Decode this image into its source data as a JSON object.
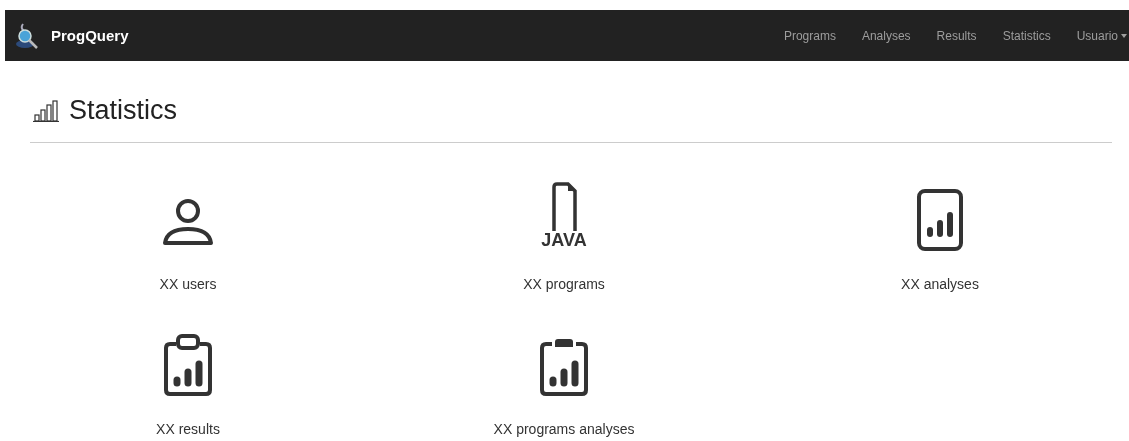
{
  "navbar": {
    "brand": "ProgQuery",
    "links": [
      {
        "label": "Programs"
      },
      {
        "label": "Analyses"
      },
      {
        "label": "Results"
      },
      {
        "label": "Statistics"
      }
    ],
    "user_menu": "Usuario"
  },
  "page_title": "Statistics",
  "stats": [
    {
      "kind": "user",
      "label": "XX users"
    },
    {
      "kind": "java-file",
      "icon_text": "JAVA",
      "label": "XX programs"
    },
    {
      "kind": "chart-doc",
      "label": "XX analyses"
    },
    {
      "kind": "clipboard",
      "label": "XX results"
    },
    {
      "kind": "clipboard-filled",
      "label": "XX programs analyses"
    }
  ]
}
